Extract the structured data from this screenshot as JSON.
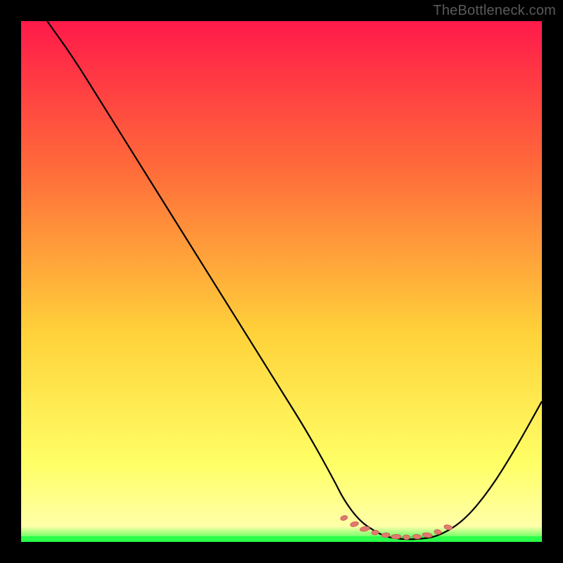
{
  "watermark": "TheBottleneck.com",
  "colors": {
    "bg_black": "#000000",
    "grad_top": "#ff1a4a",
    "grad_mid_upper": "#ff6a3a",
    "grad_mid": "#ffd23a",
    "grad_lower": "#ffff66",
    "grad_bottom": "#ffffa8",
    "green": "#2bff4a",
    "curve": "#000000",
    "marker_fill": "#e07a6f",
    "marker_stroke": "#c85d53"
  },
  "chart_data": {
    "type": "line",
    "title": "",
    "xlabel": "",
    "ylabel": "",
    "xlim": [
      0,
      100
    ],
    "ylim": [
      0,
      100
    ],
    "series": [
      {
        "name": "bottleneck-curve",
        "x": [
          5,
          10,
          15,
          20,
          25,
          30,
          35,
          40,
          45,
          50,
          55,
          60,
          62,
          65,
          68,
          70,
          73,
          76,
          80,
          85,
          90,
          95,
          100
        ],
        "y": [
          100,
          93,
          85,
          77,
          69,
          61,
          53,
          45,
          37,
          29,
          21,
          12,
          8,
          4,
          2,
          1,
          0.5,
          0.5,
          1,
          4,
          10,
          18,
          27
        ]
      }
    ],
    "markers": {
      "name": "optimal-zone-dots",
      "x": [
        62,
        64,
        66,
        68,
        70,
        72,
        74,
        76,
        78,
        80,
        82
      ],
      "y": [
        4.6,
        3.4,
        2.5,
        1.8,
        1.3,
        1.0,
        0.9,
        1.0,
        1.3,
        1.9,
        2.8
      ]
    },
    "annotations": []
  }
}
